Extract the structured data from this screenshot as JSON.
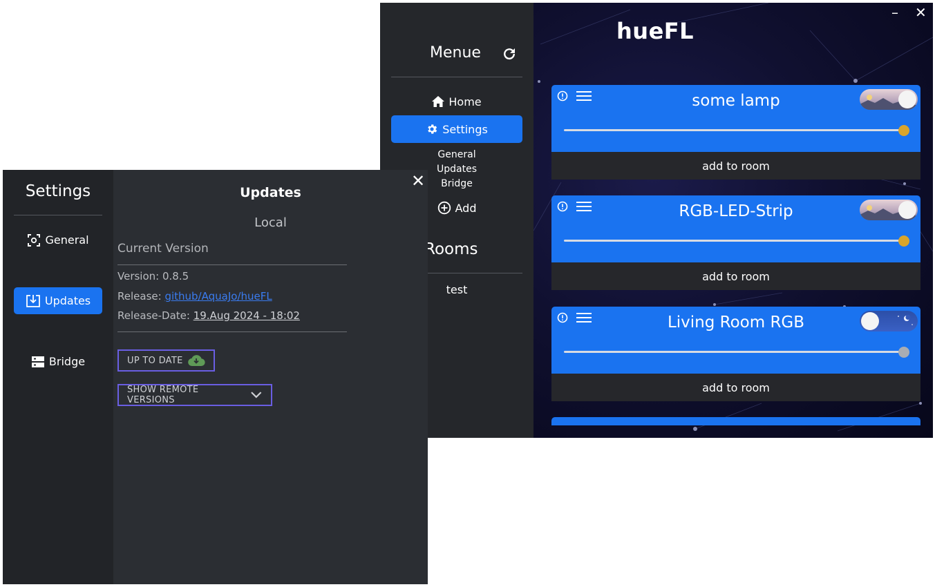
{
  "main_window": {
    "app_title": "hueFL",
    "minimize_label": "–",
    "close_label": "✕",
    "sidebar": {
      "menu_title": "Menue",
      "nav": [
        {
          "label": "Home",
          "icon": "home-icon"
        },
        {
          "label": "Settings",
          "icon": "gear-icon",
          "active": true
        }
      ],
      "settings_subitems": [
        "General",
        "Updates",
        "Bridge"
      ],
      "add_label": "Add",
      "rooms_title": "Rooms",
      "rooms": [
        "test"
      ]
    },
    "lamps": [
      {
        "name": "some lamp",
        "on": true,
        "brightness": 1.0,
        "knob_color": "#d9a52c",
        "room_button": "add to room"
      },
      {
        "name": "RGB-LED-Strip",
        "on": true,
        "brightness": 1.0,
        "knob_color": "#d9a52c",
        "room_button": "add to room"
      },
      {
        "name": "Living Room RGB",
        "on": false,
        "brightness": 1.0,
        "knob_color": "#a9adb4",
        "room_button": "add to room"
      }
    ]
  },
  "settings_window": {
    "title": "Settings",
    "close_label": "✕",
    "nav": [
      {
        "label": "General",
        "icon": "focus-icon"
      },
      {
        "label": "Updates",
        "icon": "download-icon",
        "active": true
      },
      {
        "label": "Bridge",
        "icon": "server-icon"
      }
    ],
    "heading": "Updates",
    "section_label": "Local",
    "current_version_label": "Current Version",
    "version_line": "Version: 0.8.5",
    "release_prefix": "Release: ",
    "release_link": "github/AquaJo/hueFL",
    "release_date_prefix": "Release-Date: ",
    "release_date": "19.Aug 2024 - 18:02",
    "up_to_date_button": "UP TO DATE",
    "remote_versions_button": "SHOW REMOTE VERSIONS"
  },
  "colors": {
    "accent": "#1a73f0",
    "outline_button": "#6a5ee3",
    "sidebar": "#25272b",
    "panel": "#2b2e33"
  }
}
